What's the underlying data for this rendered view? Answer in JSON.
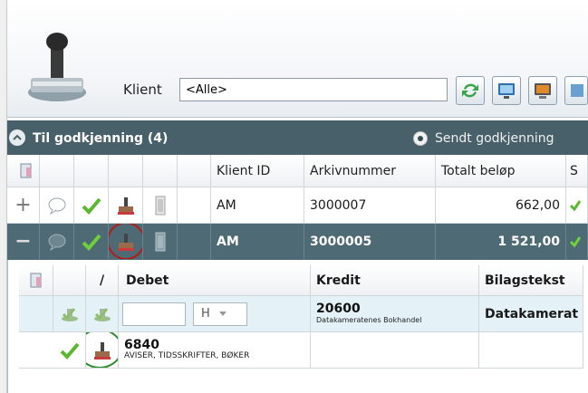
{
  "header": {
    "klient_label": "Klient",
    "klient_value": "<Alle>"
  },
  "section": {
    "title": "Til godkjenning (4)",
    "radio_label": "Sendt godkjenning"
  },
  "grid": {
    "columns": [
      "Klient ID",
      "Arkivnummer",
      "Totalt beløp",
      "S"
    ],
    "rows": [
      {
        "expand": "+",
        "klient_id": "AM",
        "arkivnummer": "3000007",
        "totalt": "662,00"
      },
      {
        "expand": "−",
        "klient_id": "AM",
        "arkivnummer": "3000005",
        "totalt": "1 521,00"
      }
    ]
  },
  "detail": {
    "columns": [
      "/",
      "Debet",
      "Kredit",
      "Bilagstekst"
    ],
    "input_row": {
      "select_value": "H",
      "kredit_code": "20600",
      "kredit_name": "Datakameratenes Bokhandel",
      "bilagstekst": "Datakamerat"
    },
    "line_row": {
      "debet_code": "6840",
      "debet_name": "AVISER, TIDSSKRIFTER, BØKER"
    }
  },
  "colors": {
    "section_bar": "#48606a",
    "selected_row": "#4e6b75",
    "highlight_red": "#b31b1b",
    "highlight_green": "#2e8b2e",
    "check_green": "#5cb82e"
  }
}
